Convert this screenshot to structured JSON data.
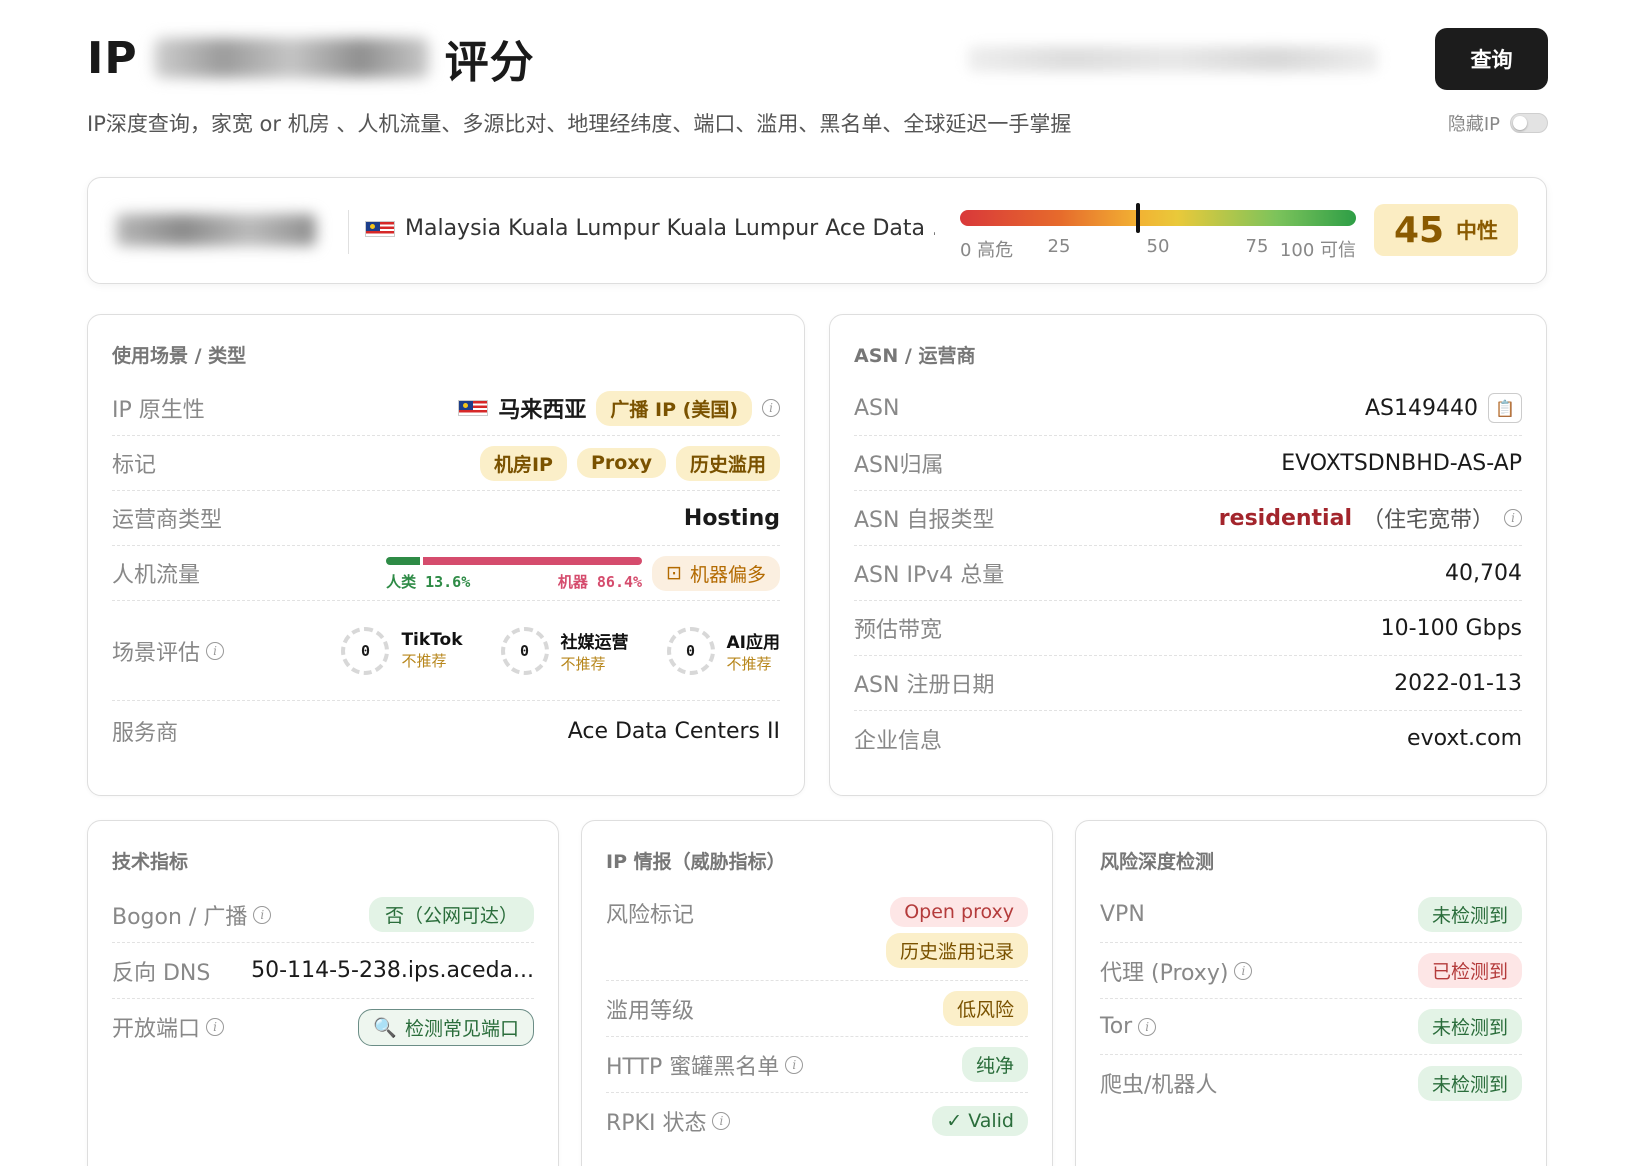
{
  "header": {
    "title_prefix": "IP",
    "title_suffix": "评分",
    "subtitle": "IP深度查询，家宽 or 机房 、人机流量、多源比对、地理经纬度、端口、滥用、黑名单、全球延迟一手掌握",
    "query_button": "查询",
    "hide_ip_label": "隐藏IP"
  },
  "summary": {
    "location": "Malaysia Kuala Lumpur Kuala Lumpur Ace Data ...",
    "gauge_labels": [
      "0 高危",
      "25",
      "50",
      "75",
      "100 可信"
    ],
    "score": "45",
    "score_value": 45,
    "score_label": "中性"
  },
  "usage_card": {
    "title": "使用场景 / 类型",
    "rows": {
      "native_label": "IP 原生性",
      "native_country": "马来西亚",
      "native_badge": "广播 IP (美国)",
      "tags_label": "标记",
      "tags": [
        "机房IP",
        "Proxy",
        "历史滥用"
      ],
      "isp_type_label": "运营商类型",
      "isp_type_value": "Hosting",
      "traffic_label": "人机流量",
      "traffic_human": "人类 13.6%",
      "traffic_bot": "机器 86.4%",
      "traffic_human_pct": 13.6,
      "traffic_bot_pct": 86.4,
      "traffic_badge": "机器偏多",
      "scene_label": "场景评估",
      "scenes": [
        {
          "score": "0",
          "name": "TikTok",
          "status": "不推荐"
        },
        {
          "score": "0",
          "name": "社媒运营",
          "status": "不推荐"
        },
        {
          "score": "0",
          "name": "AI应用",
          "status": "不推荐"
        }
      ],
      "provider_label": "服务商",
      "provider_value": "Ace Data Centers II"
    }
  },
  "asn_card": {
    "title": "ASN / 运营商",
    "asn_label": "ASN",
    "asn_value": "AS149440",
    "owner_label": "ASN归属",
    "owner_value": "EVOXTSDNBHD-AS-AP",
    "self_type_label": "ASN 自报类型",
    "self_type_value": "residential",
    "self_type_note": "（住宅宽带）",
    "ipv4_label": "ASN IPv4 总量",
    "ipv4_value": "40,704",
    "bandwidth_label": "预估带宽",
    "bandwidth_value": "10-100 Gbps",
    "reg_date_label": "ASN 注册日期",
    "reg_date_value": "2022-01-13",
    "company_label": "企业信息",
    "company_value": "evoxt.com"
  },
  "tech_card": {
    "title": "技术指标",
    "bogon_label": "Bogon / 广播",
    "bogon_value": "否（公网可达）",
    "rdns_label": "反向 DNS",
    "rdns_value": "50-114-5-238.ips.aceda...",
    "ports_label": "开放端口",
    "ports_button": "检测常见端口"
  },
  "intel_card": {
    "title": "IP 情报（威胁指标）",
    "risk_tags_label": "风险标记",
    "risk_tags": [
      "Open proxy",
      "历史滥用记录"
    ],
    "abuse_label": "滥用等级",
    "abuse_value": "低风险",
    "honeypot_label": "HTTP 蜜罐黑名单",
    "honeypot_value": "纯净",
    "rpki_label": "RPKI 状态",
    "rpki_value": "✓ Valid"
  },
  "risk_card": {
    "title": "风险深度检测",
    "vpn_label": "VPN",
    "vpn_value": "未检测到",
    "proxy_label": "代理 (Proxy)",
    "proxy_value": "已检测到",
    "tor_label": "Tor",
    "tor_value": "未检测到",
    "crawler_label": "爬虫/机器人",
    "crawler_value": "未检测到"
  },
  "colors": {
    "accent_dark": "#1c1c1c",
    "neutral_badge": "#fbedc3",
    "human": "#2e8b46",
    "bot": "#d54c6d",
    "residential": "#a3252c"
  }
}
